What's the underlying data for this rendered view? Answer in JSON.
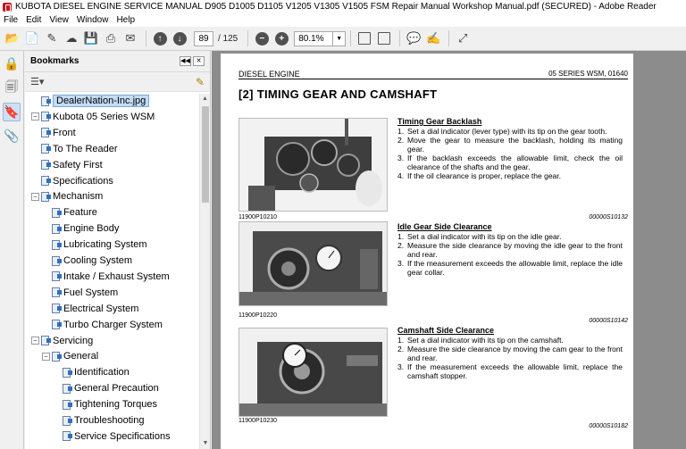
{
  "window": {
    "title": "KUBOTA DIESEL ENGINE SERVICE MANUAL D905 D1005 D1105 V1205 V1305 V1505  FSM  Repair Manual   Workshop Manual.pdf (SECURED) - Adobe Reader"
  },
  "menu": [
    "File",
    "Edit",
    "View",
    "Window",
    "Help"
  ],
  "toolbar": {
    "page_current": "89",
    "page_total": "/ 125",
    "zoom": "80.1%"
  },
  "bookmarks": {
    "title": "Bookmarks",
    "items": [
      {
        "label": "DealerNation-Inc.jpg",
        "level": 0,
        "expander": "",
        "selected": true
      },
      {
        "label": "Kubota 05 Series WSM",
        "level": 0,
        "expander": "−",
        "selected": false
      },
      {
        "label": "Front",
        "level": 1,
        "expander": "",
        "selected": false
      },
      {
        "label": "To The Reader",
        "level": 1,
        "expander": "",
        "selected": false
      },
      {
        "label": "Safety First",
        "level": 1,
        "expander": "",
        "selected": false
      },
      {
        "label": "Specifications",
        "level": 1,
        "expander": "",
        "selected": false
      },
      {
        "label": "Mechanism",
        "level": 1,
        "expander": "−",
        "selected": false
      },
      {
        "label": "Feature",
        "level": 2,
        "expander": "",
        "selected": false
      },
      {
        "label": "Engine Body",
        "level": 2,
        "expander": "",
        "selected": false
      },
      {
        "label": "Lubricating System",
        "level": 2,
        "expander": "",
        "selected": false
      },
      {
        "label": "Cooling System",
        "level": 2,
        "expander": "",
        "selected": false
      },
      {
        "label": "Intake / Exhaust System",
        "level": 2,
        "expander": "",
        "selected": false
      },
      {
        "label": "Fuel System",
        "level": 2,
        "expander": "",
        "selected": false
      },
      {
        "label": "Electrical System",
        "level": 2,
        "expander": "",
        "selected": false
      },
      {
        "label": "Turbo Charger System",
        "level": 2,
        "expander": "",
        "selected": false
      },
      {
        "label": "Servicing",
        "level": 1,
        "expander": "−",
        "selected": false
      },
      {
        "label": "General",
        "level": 2,
        "expander": "−",
        "selected": false
      },
      {
        "label": "Identification",
        "level": 3,
        "expander": "",
        "selected": false
      },
      {
        "label": "General Precaution",
        "level": 3,
        "expander": "",
        "selected": false
      },
      {
        "label": "Tightening Torques",
        "level": 3,
        "expander": "",
        "selected": false
      },
      {
        "label": "Troubleshooting",
        "level": 3,
        "expander": "",
        "selected": false
      },
      {
        "label": "Service Specifications",
        "level": 3,
        "expander": "",
        "selected": false
      }
    ]
  },
  "page": {
    "header_left": "DIESEL ENGINE",
    "header_right": "05 SERIES WSM, 01640",
    "heading": "[2]  TIMING  GEAR  AND  CAMSHAFT",
    "sections": [
      {
        "title": "Timing Gear Backlash",
        "steps": [
          {
            "n": "1.",
            "t": "Set a dial indicator (lever type) with its tip on the gear tooth."
          },
          {
            "n": "2.",
            "t": "Move the gear to measure the backlash, holding its mating gear."
          },
          {
            "n": "3.",
            "t": "If the backlash exceeds the allowable limit, check the oil clearance of the shafts and the gear."
          },
          {
            "n": "4.",
            "t": "If the oil clearance is proper, replace the gear."
          }
        ],
        "photo_label": "11900P10210",
        "code": "00000S10132"
      },
      {
        "title": "Idle Gear Side Clearance",
        "steps": [
          {
            "n": "1.",
            "t": "Set a dial indicator with its tip on the idle gear."
          },
          {
            "n": "2.",
            "t": "Measure the side clearance by moving the idle gear to the front and rear."
          },
          {
            "n": "3.",
            "t": "If the measurement exceeds the allowable limit, replace the idle gear collar."
          }
        ],
        "photo_label": "11900P10220",
        "code": "00000S10142"
      },
      {
        "title": "Camshaft Side Clearance",
        "steps": [
          {
            "n": "1.",
            "t": "Set a dial indicator with its tip on the camshaft."
          },
          {
            "n": "2.",
            "t": "Measure the side clearance by moving the cam gear to the front and rear."
          },
          {
            "n": "3.",
            "t": "If the measurement exceeds the allowable limit, replace the camshaft stopper."
          }
        ],
        "photo_label": "11900P10230",
        "code": "00000S10182"
      }
    ]
  }
}
